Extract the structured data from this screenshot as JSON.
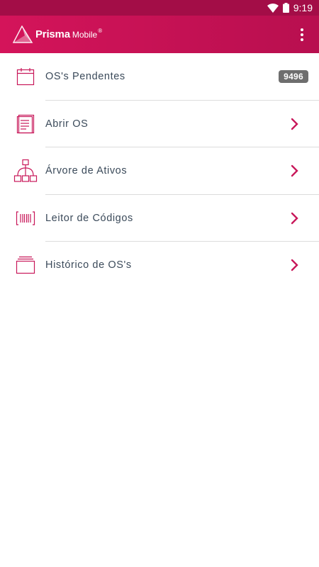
{
  "status_bar": {
    "time": "9:19",
    "wifi_icon": "wifi-icon",
    "battery_icon": "battery-icon"
  },
  "app_bar": {
    "logo_text": "Prisma",
    "logo_subtext": "Mobile",
    "logo_registered": "®",
    "menu_icon": "overflow-menu-icon",
    "accent_color": "#d4145a"
  },
  "menu": {
    "items": [
      {
        "label": "OS's Pendentes",
        "icon": "calendar-icon",
        "badge": "9496"
      },
      {
        "label": "Abrir OS",
        "icon": "document-icon",
        "chevron": "chevron-right-icon"
      },
      {
        "label": "Árvore de Ativos",
        "icon": "tree-icon",
        "chevron": "chevron-right-icon"
      },
      {
        "label": "Leitor de Códigos",
        "icon": "barcode-icon",
        "chevron": "chevron-right-icon"
      },
      {
        "label": "Histórico de OS's",
        "icon": "folders-icon",
        "chevron": "chevron-right-icon"
      }
    ]
  }
}
